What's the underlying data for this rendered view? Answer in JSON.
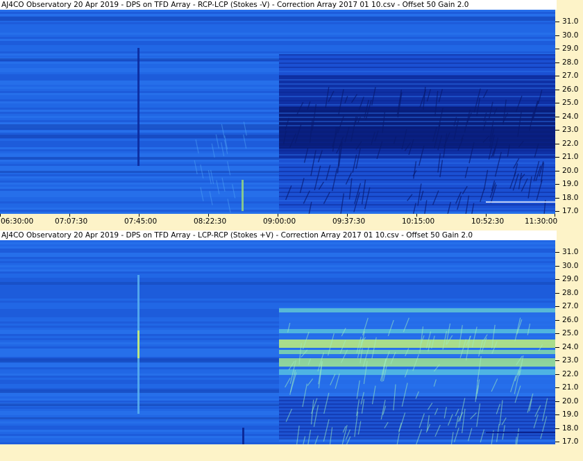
{
  "top_panel": {
    "title": "AJ4CO Observatory 20 Apr 2019  -  DPS on TFD Array  -  RCP-LCP (Stokes -V)  -  Correction Array 2017 01 10.csv  -  Offset 50  Gain 2.0",
    "freq_labels": [
      "31.0",
      "30.0",
      "29.0",
      "28.0",
      "27.0",
      "26.0",
      "25.0",
      "24.0",
      "23.0",
      "22.0",
      "21.0",
      "20.0",
      "19.0",
      "18.0",
      "17.0"
    ]
  },
  "time_axis": {
    "labels": [
      "06:30:00",
      "07:07:30",
      "07:45:00",
      "08:22:30",
      "09:00:00",
      "09:37:30",
      "10:15:00",
      "10:52:30",
      "11:30:00"
    ]
  },
  "bottom_panel": {
    "title": "AJ4CO Observatory 20 Apr 2019  -  DPS on TFD Array  -  LCP-RCP (Stokes +V)  -  Correction Array 2017 01 10.csv  -  Offset 50  Gain 2.0",
    "freq_labels": [
      "31.0",
      "30.0",
      "29.0",
      "28.0",
      "27.0",
      "26.0",
      "25.0",
      "24.0",
      "23.0",
      "22.0",
      "21.0",
      "20.0",
      "19.0",
      "18.0",
      "17.0"
    ]
  },
  "colors": {
    "background": "#fdf3c8",
    "spectro_base": "#1f5fe0",
    "spectro_dark": "#0a1f8a",
    "spectro_bright": "#8fe88a"
  }
}
